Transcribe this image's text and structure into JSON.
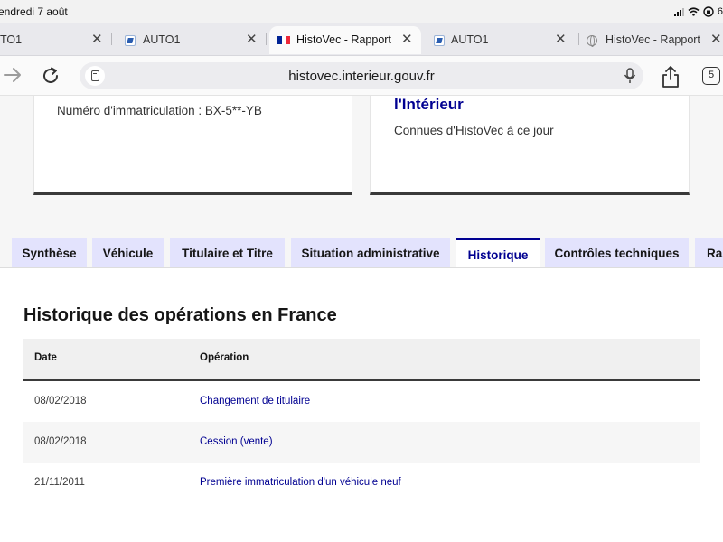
{
  "status_bar": {
    "time": "endredi 7 août",
    "battery": "6"
  },
  "browser": {
    "tabs": [
      {
        "title": "TO1",
        "favicon": "auto1-icon"
      },
      {
        "title": "AUTO1",
        "favicon": "auto1-icon"
      },
      {
        "title": "HistoVec - Rapport",
        "favicon": "french-flag-icon",
        "active": true
      },
      {
        "title": "AUTO1",
        "favicon": "auto1-icon"
      },
      {
        "title": "HistoVec - Rapport",
        "favicon": "globe-icon"
      }
    ],
    "close_glyph": "✕",
    "url": "histovec.interieur.gouv.fr",
    "tab_count": "5"
  },
  "cards": {
    "left": {
      "registration": "Numéro d'immatriculation : BX-5**-YB"
    },
    "right": {
      "title": "l'Intérieur",
      "subtitle": "Connues d'HistoVec à ce jour"
    }
  },
  "page_tabs": [
    {
      "label": "Synthèse"
    },
    {
      "label": "Véhicule"
    },
    {
      "label": "Titulaire et Titre"
    },
    {
      "label": "Situation administrative"
    },
    {
      "label": "Historique",
      "active": true
    },
    {
      "label": "Contrôles techniques"
    },
    {
      "label": "Ra"
    }
  ],
  "historique": {
    "title": "Historique des opérations en France",
    "columns": [
      "Date",
      "Opération"
    ],
    "rows": [
      {
        "date": "08/02/2018",
        "operation": "Changement de titulaire"
      },
      {
        "date": "08/02/2018",
        "operation": "Cession (vente)"
      },
      {
        "date": "21/11/2011",
        "operation": "Première immatriculation d'un véhicule neuf"
      }
    ]
  },
  "colors": {
    "accent": "#000091",
    "tab_inactive": "#e3e3fd",
    "flag_blue": "#002395",
    "flag_white": "#ffffff",
    "flag_red": "#ed2939"
  }
}
